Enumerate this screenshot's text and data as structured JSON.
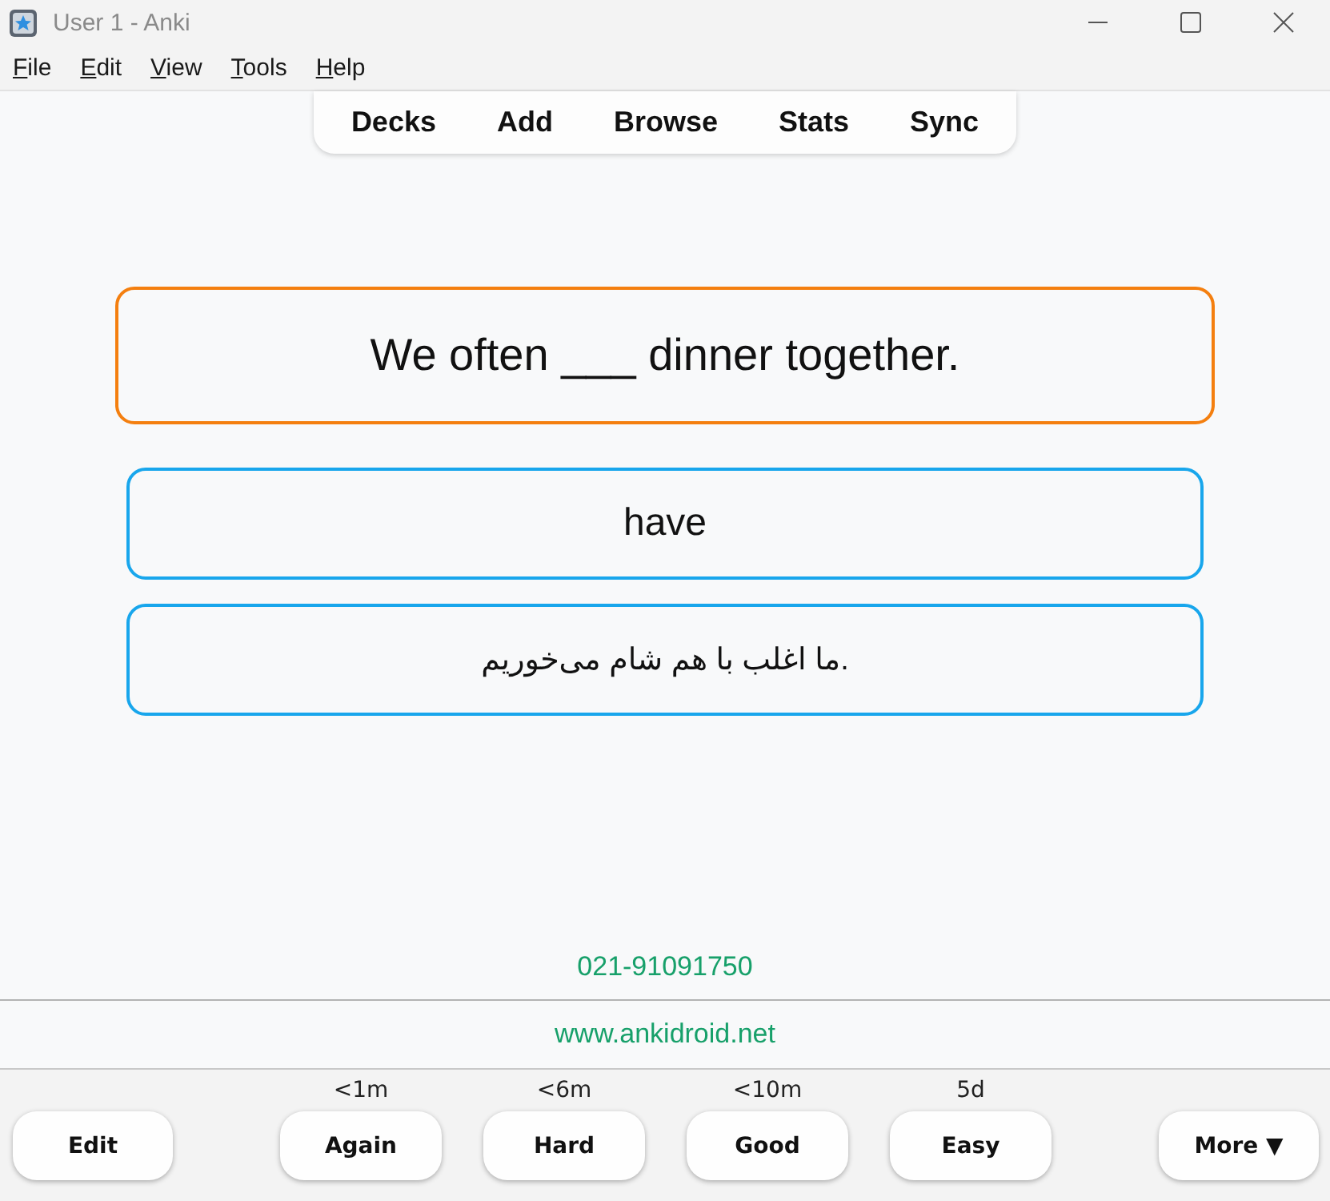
{
  "window": {
    "title": "User 1 - Anki"
  },
  "menu": [
    "File",
    "Edit",
    "View",
    "Tools",
    "Help"
  ],
  "toolbar": [
    "Decks",
    "Add",
    "Browse",
    "Stats",
    "Sync"
  ],
  "card": {
    "question": "We often ___ dinner together.",
    "answers": [
      "have",
      "ما اغلب با هم شام می‌خوریم."
    ],
    "phone": "021-91091750",
    "website": "www.ankidroid.net"
  },
  "bottom_bar": {
    "edit": "Edit",
    "answers": [
      {
        "label": "Again",
        "interval": "<1m"
      },
      {
        "label": "Hard",
        "interval": "<6m"
      },
      {
        "label": "Good",
        "interval": "<10m"
      },
      {
        "label": "Easy",
        "interval": "5d"
      }
    ],
    "more": "More ▼"
  }
}
